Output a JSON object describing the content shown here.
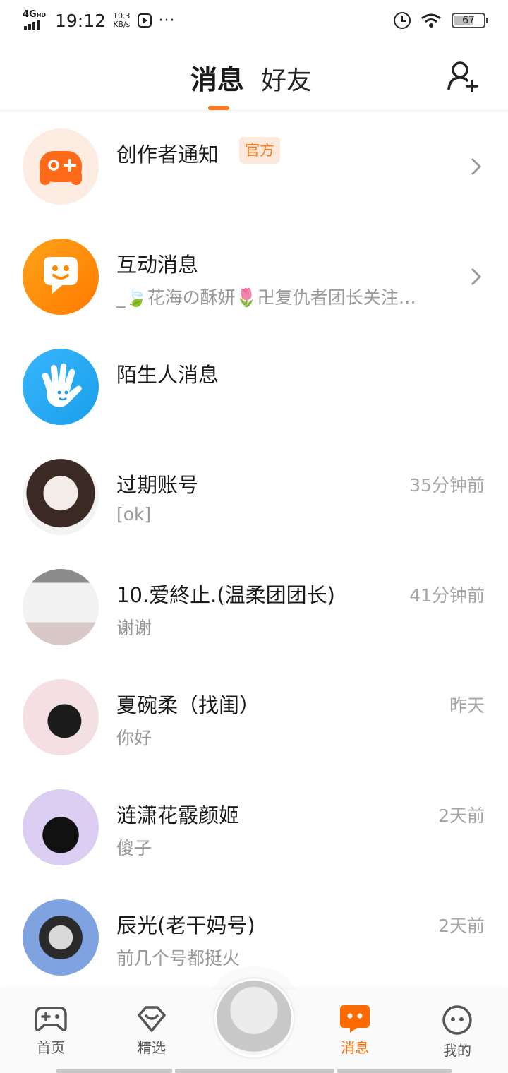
{
  "status_bar": {
    "network": "4G",
    "network_sup": "HD",
    "time": "19:12",
    "speed_value": "10.3",
    "speed_unit": "KB/s",
    "more": "···",
    "battery": "67"
  },
  "header": {
    "tabs": [
      {
        "label": "消息",
        "active": true
      },
      {
        "label": "好友",
        "active": false
      }
    ],
    "add_friend_icon": "add-user-icon",
    "accent": "#ff7a1a"
  },
  "messages": [
    {
      "title": "创作者通知",
      "badge": "官方",
      "subtitle": "",
      "time": "",
      "has_arrow": true,
      "icon": "gamepad-plus-icon"
    },
    {
      "title": "互动消息",
      "subtitle": "_🍃花海の酥妍🌷卍复仇者团长关注…",
      "time": "",
      "has_arrow": true,
      "icon": "smile-chat-icon"
    },
    {
      "title": "陌生人消息",
      "subtitle": "",
      "time": "",
      "has_arrow": false,
      "icon": "wave-hand-icon"
    },
    {
      "title": "过期账号",
      "subtitle": "[ok]",
      "time": "35分钟前"
    },
    {
      "title": "10.爱終止.(温柔团团长)",
      "subtitle": "谢谢",
      "time": "41分钟前"
    },
    {
      "title": "夏碗柔（找闺）",
      "subtitle": "你好",
      "time": "昨天"
    },
    {
      "title": "涟潇花霰颜姬",
      "subtitle": "傻子",
      "time": "2天前"
    },
    {
      "title": "辰光(老干妈号)",
      "subtitle": "前几个号都挺火",
      "time": "2天前"
    }
  ],
  "bottom_nav": [
    {
      "label": "首页",
      "icon": "gamepad-icon",
      "active": false
    },
    {
      "label": "精选",
      "icon": "heart-badge-icon",
      "active": false
    },
    {
      "label": "消息",
      "icon": "message-icon",
      "active": true
    },
    {
      "label": "我的",
      "icon": "face-icon",
      "active": false
    }
  ]
}
